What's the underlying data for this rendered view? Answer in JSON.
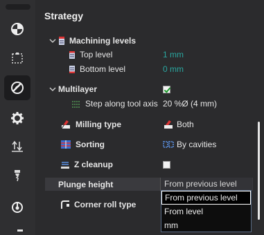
{
  "panel": {
    "title": "Strategy"
  },
  "machining_levels": {
    "label": "Machining levels",
    "top_level": {
      "label": "Top level",
      "value": "1 mm"
    },
    "bottom_level": {
      "label": "Bottom level",
      "value": "0 mm"
    }
  },
  "multilayer": {
    "label": "Multilayer",
    "checked": true,
    "step": {
      "label": "Step along tool axis",
      "value": "20 %Ø (4 mm)"
    }
  },
  "milling_type": {
    "label": "Milling type",
    "value": "Both"
  },
  "sorting": {
    "label": "Sorting",
    "value": "By cavities"
  },
  "z_cleanup": {
    "label": "Z cleanup",
    "checked": false
  },
  "plunge_height": {
    "label": "Plunge height",
    "value": "From previous level",
    "options": [
      "From previous level",
      "From level",
      "mm"
    ]
  },
  "corner_roll": {
    "label": "Corner roll type"
  },
  "colors": {
    "accent_teal": "#2aa7a0",
    "check_green": "#1a9a2a"
  },
  "rail_icons": [
    "pie-chart-icon",
    "selection-box-icon",
    "toolpath-disc-icon",
    "gear-icon",
    "arrows-updown-icon",
    "drill-bit-icon",
    "tool-holder-icon"
  ]
}
